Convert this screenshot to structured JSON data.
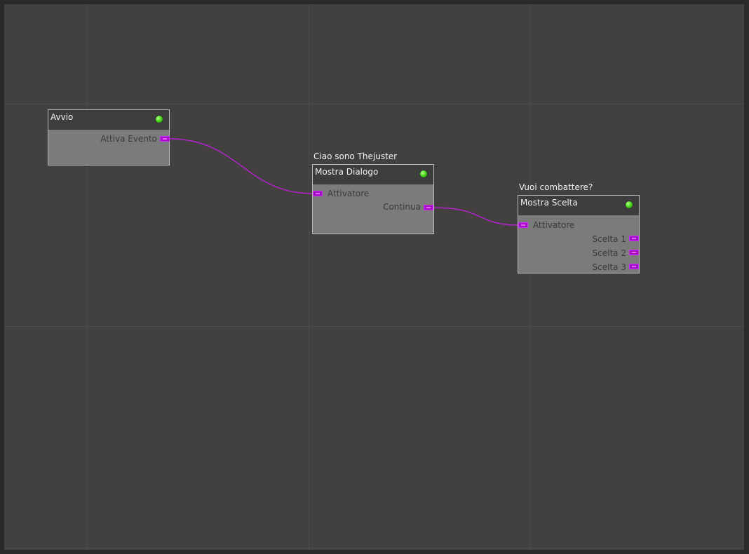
{
  "colors": {
    "background": "#434140",
    "frame": "#2b2a28",
    "grid": "#4e4c4a",
    "node_body": "#7b7b7b",
    "node_header": "#3d3d3d",
    "wire": "#c21ee0",
    "port": "#a110c4",
    "status_active": "#4bdc1c"
  },
  "nodes": {
    "avvio": {
      "title": "Avvio",
      "status_icon": "status-dot-icon",
      "outputs": [
        "Attiva Evento"
      ]
    },
    "mostra_dialogo": {
      "caption": "Ciao sono Thejuster",
      "title": "Mostra Dialogo",
      "status_icon": "status-dot-icon",
      "inputs": [
        "Attivatore"
      ],
      "outputs": [
        "Continua"
      ]
    },
    "mostra_scelta": {
      "caption": "Vuoi combattere?",
      "title": "Mostra Scelta",
      "status_icon": "status-dot-icon",
      "inputs": [
        "Attivatore"
      ],
      "outputs": [
        "Scelta 1",
        "Scelta 2",
        "Scelta 3"
      ]
    }
  },
  "connections": [
    {
      "from": "Avvio.Attiva Evento",
      "to": "Mostra Dialogo.Attivatore"
    },
    {
      "from": "Mostra Dialogo.Continua",
      "to": "Mostra Scelta.Attivatore"
    }
  ]
}
